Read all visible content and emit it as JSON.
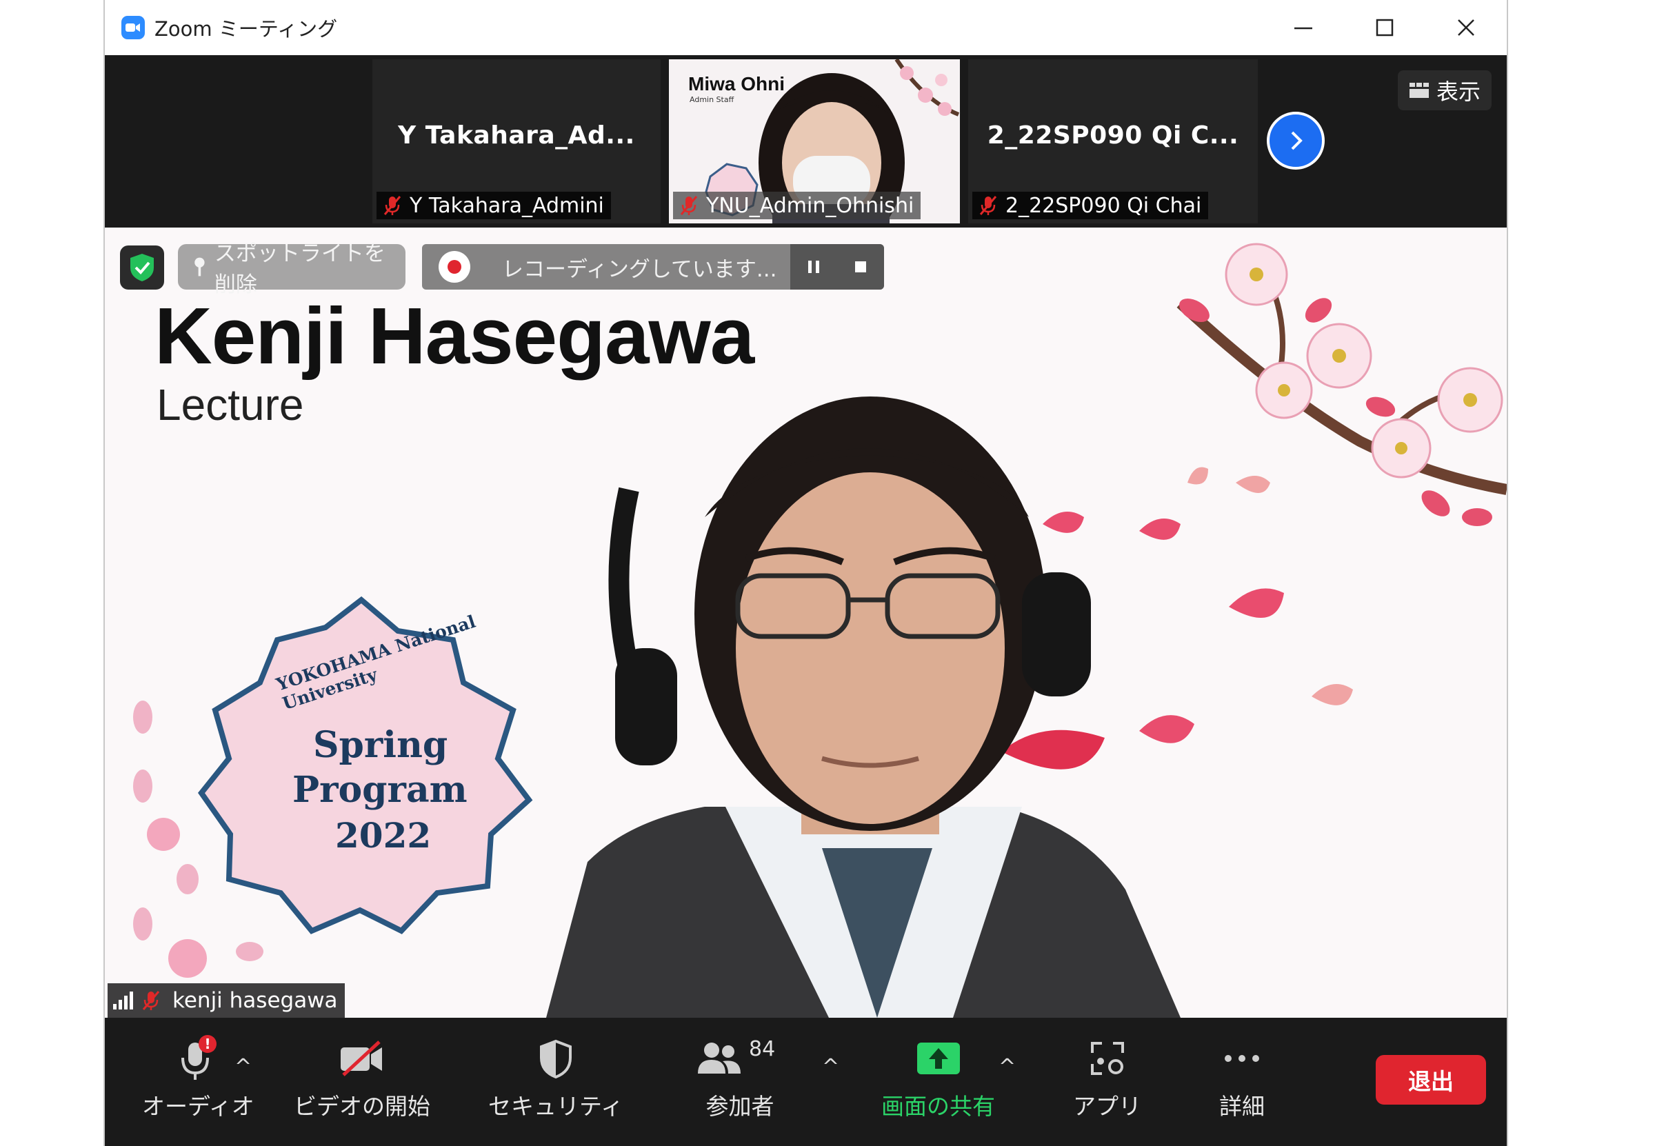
{
  "window": {
    "title": "Zoom ミーティング"
  },
  "strip": {
    "view_label": "表示",
    "participants": [
      {
        "display_name": "Y  Takahara_Ad...",
        "label": "Y Takahara_Admini"
      },
      {
        "video_overlay_name": "Miwa Ohni",
        "video_overlay_role": "Admin Staff",
        "label": "YNU_Admin_Ohnishi"
      },
      {
        "display_name": "2_22SP090 Qi C...",
        "label": "2_22SP090 Qi Chai"
      }
    ]
  },
  "stage": {
    "spotlight_label": "スポットライトを削除",
    "recording_label": "レコーディングしています...",
    "speaker_title": "Kenji Hasegawa",
    "speaker_subtitle": "Lecture",
    "badge": {
      "arc_text": "YOKOHAMA National University",
      "line1": "Spring",
      "line2": "Program",
      "line3": "2022"
    },
    "speaker_label": "kenji hasegawa"
  },
  "toolbar": {
    "audio": "オーディオ",
    "video": "ビデオの開始",
    "security": "セキュリティ",
    "participants": "参加者",
    "participants_count": "84",
    "share": "画面の共有",
    "apps": "アプリ",
    "more": "詳細",
    "leave": "退出"
  },
  "colors": {
    "zoom_blue": "#2d8cff",
    "share_green": "#2bd368",
    "leave_red": "#e0252f",
    "sakura_pink": "#f3a7bd"
  }
}
